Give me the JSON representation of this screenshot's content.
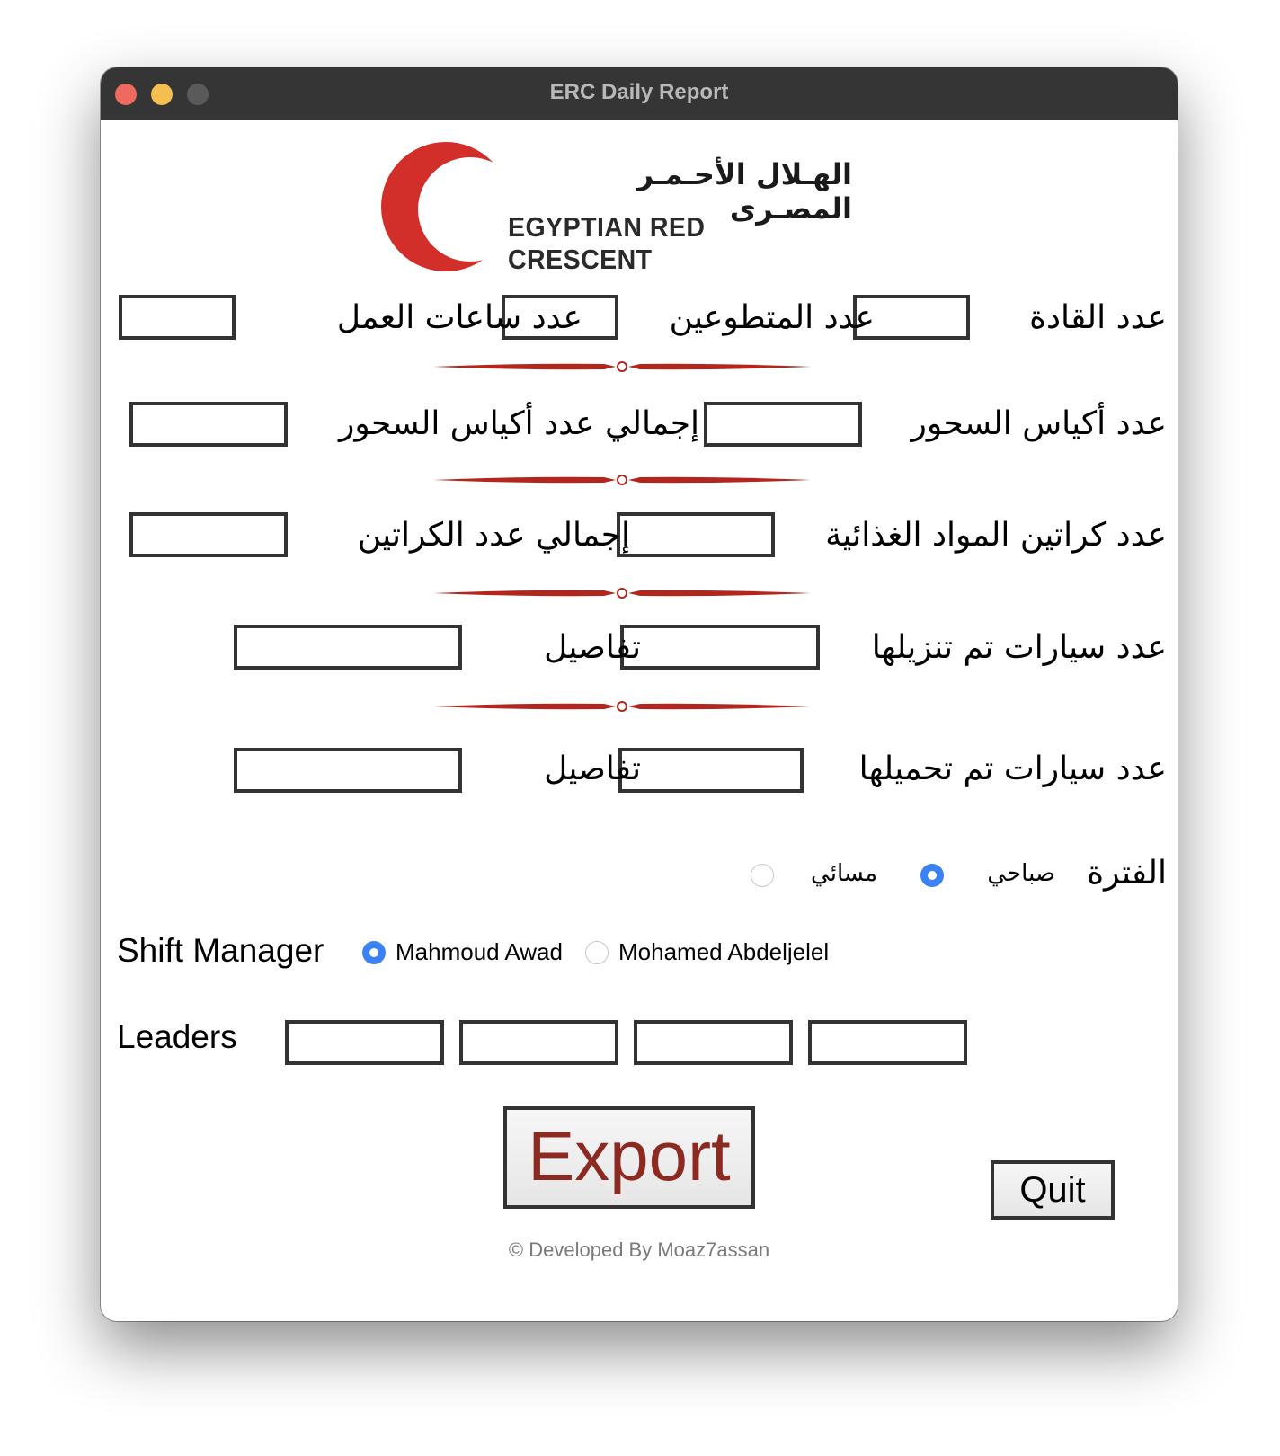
{
  "window": {
    "title": "ERC Daily Report"
  },
  "logo": {
    "arabic_text": "الهـلال الأحـمـر المصـرى",
    "english_text": "EGYPTIAN RED CRESCENT",
    "crescent_color": "#d32f2a"
  },
  "form": {
    "row1": {
      "leaders_count": "عدد القادة",
      "volunteers_count": "عدد المتطوعين",
      "work_hours": "عدد ساعات العمل"
    },
    "row2": {
      "suhoor_bags": "عدد أكياس السحور",
      "total_suhoor_bags": "إجمالي عدد أكياس السحور"
    },
    "row3": {
      "food_cartons": "عدد كراتين المواد الغذائية",
      "total_cartons": "إجمالي عدد الكراتين"
    },
    "row4": {
      "cars_unloaded": "عدد سيارات تم تنزيلها",
      "details": "تفاصيل"
    },
    "row5": {
      "cars_loaded": "عدد سيارات تم تحميلها",
      "details": "تفاصيل"
    }
  },
  "period": {
    "label": "الفترة",
    "options": [
      {
        "label": "صباحي",
        "selected": true
      },
      {
        "label": "مسائي",
        "selected": false
      }
    ]
  },
  "shift_manager": {
    "label": "Shift Manager",
    "options": [
      {
        "label": "Mahmoud Awad",
        "selected": true
      },
      {
        "label": "Mohamed Abdeljelel",
        "selected": false
      }
    ]
  },
  "leaders": {
    "label": "Leaders"
  },
  "buttons": {
    "export": "Export",
    "quit": "Quit"
  },
  "footer": "© Developed By Moaz7assan",
  "colors": {
    "accent_red": "#8c2a22",
    "divider_red": "#b3261e",
    "radio_blue": "#3b82f6"
  }
}
